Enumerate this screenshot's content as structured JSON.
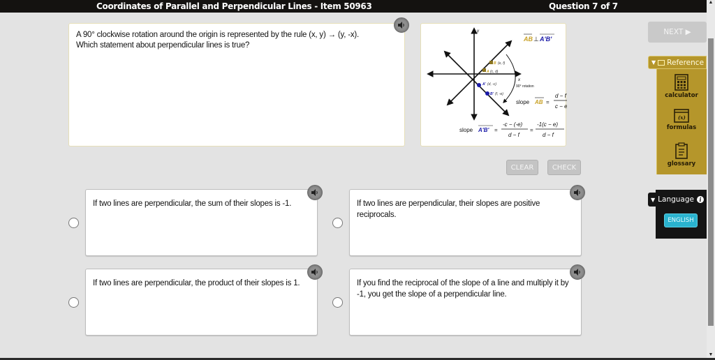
{
  "header": {
    "title": "Coordinates of Parallel and Perpendicular Lines - Item 50963",
    "question_counter": "Question 7 of 7"
  },
  "question": {
    "line1": "A 90° clockwise rotation around the origin is represented by the rule (x, y) → (y, -x).",
    "line2": "Which statement about perpendicular lines is true?"
  },
  "figure": {
    "perp_statement_left": "AB",
    "perp_symbol": "⊥",
    "perp_statement_right": "A'B'",
    "axis_x": "x",
    "axis_y": "y",
    "point_B": "B",
    "point_B_coords": "(e, f)",
    "point_A": "A",
    "point_A_coords": "(c, d)",
    "point_A_prime": "A'",
    "point_A_prime_coords": "(d, -c)",
    "point_B_prime": "B'",
    "point_B_prime_coords": "(f, -e)",
    "rotation_label": "90° rotation",
    "slope_label": "slope",
    "slope_AB_num": "d − f",
    "slope_AB_den": "c − e",
    "slope_ApBp_num1": "-c − (-e)",
    "slope_ApBp_den1": "d − f",
    "slope_ApBp_num2": "-1(c − e)",
    "slope_ApBp_den2": "d − f",
    "equals": "=",
    "colors": {
      "ab": "#c9a227",
      "apbp": "#1a1aa8"
    }
  },
  "buttons": {
    "next": "NEXT ▶",
    "clear": "CLEAR",
    "check": "CHECK"
  },
  "reference": {
    "header": "Reference",
    "items": [
      {
        "label": "calculator",
        "icon": "calculator-icon"
      },
      {
        "label": "formulas",
        "icon": "formulas-icon"
      },
      {
        "label": "glossary",
        "icon": "glossary-icon"
      }
    ]
  },
  "language": {
    "header": "Language",
    "selected": "ENGLISH"
  },
  "choices": [
    {
      "text": "If two lines are perpendicular, the sum of their slopes is -1."
    },
    {
      "text": "If two lines are perpendicular, their slopes are positive reciprocals."
    },
    {
      "text": "If two lines are perpendicular, the product of their slopes is 1."
    },
    {
      "text": "If you find the reciprocal of the slope of a line and multiply it by -1, you get the slope of a perpendicular line."
    }
  ]
}
